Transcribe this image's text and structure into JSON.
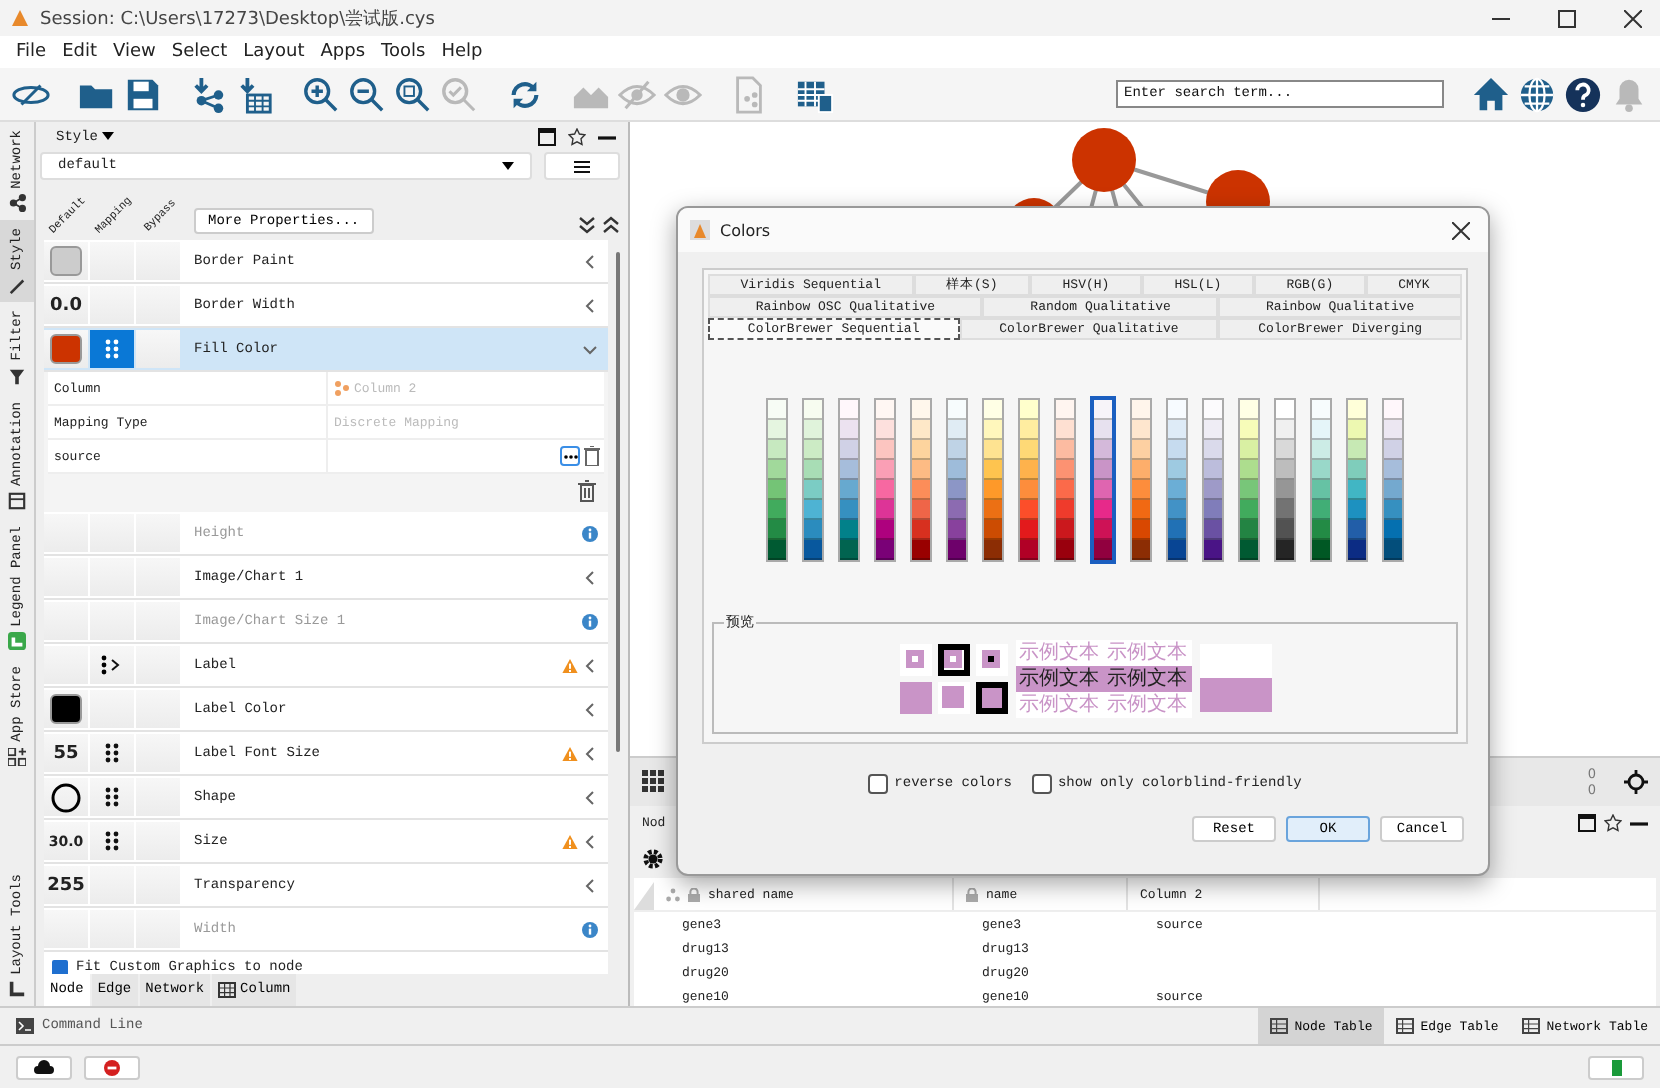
{
  "window": {
    "title": "Session: C:\\Users\\17273\\Desktop\\尝试版.cys"
  },
  "menu": [
    "File",
    "Edit",
    "View",
    "Select",
    "Layout",
    "Apps",
    "Tools",
    "Help"
  ],
  "toolbar": [
    [
      {
        "kind": "logo",
        "disabled": false
      }
    ],
    [
      {
        "kind": "open",
        "disabled": false
      },
      {
        "kind": "save",
        "disabled": false
      }
    ],
    [
      {
        "kind": "import-network",
        "disabled": false
      },
      {
        "kind": "import-table",
        "disabled": false
      }
    ],
    [
      {
        "kind": "zoom-in",
        "disabled": false
      },
      {
        "kind": "zoom-out",
        "disabled": false
      },
      {
        "kind": "zoom-fit",
        "disabled": false
      },
      {
        "kind": "zoom-selected",
        "disabled": true
      }
    ],
    [
      {
        "kind": "refresh",
        "disabled": false
      }
    ],
    [
      {
        "kind": "houses",
        "disabled": true
      },
      {
        "kind": "eye-slash",
        "disabled": true
      },
      {
        "kind": "eye",
        "disabled": true
      }
    ],
    [
      {
        "kind": "export",
        "disabled": true
      }
    ],
    [
      {
        "kind": "table",
        "disabled": false
      }
    ]
  ],
  "search": {
    "placeholder": "Enter search term..."
  },
  "toolbar_right": [
    {
      "kind": "home",
      "disabled": false
    },
    {
      "kind": "globe",
      "disabled": false
    },
    {
      "kind": "help",
      "disabled": false
    },
    {
      "kind": "bell",
      "disabled": true
    }
  ],
  "side_tabs": [
    {
      "label": "Network",
      "kind": "network",
      "selected": false
    },
    {
      "label": "Style",
      "kind": "style",
      "selected": true
    },
    {
      "label": "Filter",
      "kind": "filter",
      "selected": false
    },
    {
      "label": "Annotation",
      "kind": "annotation",
      "selected": false
    },
    {
      "label": "Legend Panel",
      "kind": "legend",
      "selected": false
    },
    {
      "label": "App Store",
      "kind": "apps",
      "selected": false
    },
    {
      "label": "Layout Tools",
      "kind": "layout",
      "selected": false
    }
  ],
  "style_panel": {
    "title": "Style",
    "style_name": "default",
    "column_headers": [
      "Default",
      "Mapping",
      "Bypass"
    ],
    "more_button": "More Properties...",
    "properties": [
      {
        "label": "Border Paint",
        "default": {
          "kind": "swatch",
          "color": "#cccccc"
        },
        "mapping": {
          "kind": "none"
        },
        "selected": false,
        "disabled": false,
        "warning": false,
        "info": false,
        "expanded": false
      },
      {
        "label": "Border Width",
        "default": {
          "kind": "number",
          "text": "0.0"
        },
        "mapping": {
          "kind": "none"
        },
        "selected": false,
        "disabled": false,
        "warning": false,
        "info": false,
        "expanded": false
      },
      {
        "label": "Fill Color",
        "default": {
          "kind": "swatch",
          "color": "#cc3300"
        },
        "mapping": {
          "kind": "discrete"
        },
        "selected": true,
        "disabled": false,
        "warning": false,
        "info": false,
        "expanded": true,
        "detail": [
          {
            "kind": "column",
            "key": "Column",
            "value": "Column 2"
          },
          {
            "kind": "type",
            "key": "Mapping Type",
            "value": "Discrete Mapping"
          },
          {
            "kind": "entry",
            "key": "source"
          }
        ]
      },
      {
        "label": "Height",
        "default": {
          "kind": "none"
        },
        "mapping": {
          "kind": "none"
        },
        "selected": false,
        "disabled": true,
        "warning": false,
        "info": true,
        "expanded": false
      },
      {
        "label": "Image/Chart 1",
        "default": {
          "kind": "none"
        },
        "mapping": {
          "kind": "none"
        },
        "selected": false,
        "disabled": false,
        "warning": false,
        "info": false,
        "expanded": false
      },
      {
        "label": "Image/Chart Size 1",
        "default": {
          "kind": "none"
        },
        "mapping": {
          "kind": "none"
        },
        "selected": false,
        "disabled": true,
        "warning": false,
        "info": true,
        "expanded": false
      },
      {
        "label": "Label",
        "default": {
          "kind": "none"
        },
        "mapping": {
          "kind": "passthrough"
        },
        "selected": false,
        "disabled": false,
        "warning": true,
        "info": false,
        "expanded": false
      },
      {
        "label": "Label Color",
        "default": {
          "kind": "swatch",
          "color": "#000000"
        },
        "mapping": {
          "kind": "none"
        },
        "selected": false,
        "disabled": false,
        "warning": false,
        "info": false,
        "expanded": false
      },
      {
        "label": "Label Font Size",
        "default": {
          "kind": "number",
          "text": "55"
        },
        "mapping": {
          "kind": "discrete"
        },
        "selected": false,
        "disabled": false,
        "warning": true,
        "info": false,
        "expanded": false
      },
      {
        "label": "Shape",
        "default": {
          "kind": "ellipse"
        },
        "mapping": {
          "kind": "discrete"
        },
        "selected": false,
        "disabled": false,
        "warning": false,
        "info": false,
        "expanded": false
      },
      {
        "label": "Size",
        "default": {
          "kind": "number",
          "text": "30.0"
        },
        "mapping": {
          "kind": "discrete"
        },
        "selected": false,
        "disabled": false,
        "warning": true,
        "info": false,
        "expanded": false
      },
      {
        "label": "Transparency",
        "default": {
          "kind": "number",
          "text": "255"
        },
        "mapping": {
          "kind": "none"
        },
        "selected": false,
        "disabled": false,
        "warning": false,
        "info": false,
        "expanded": false
      },
      {
        "label": "Width",
        "default": {
          "kind": "none"
        },
        "mapping": {
          "kind": "none"
        },
        "selected": false,
        "disabled": true,
        "warning": false,
        "info": true,
        "expanded": false
      }
    ],
    "fit_option": {
      "label": "Fit Custom Graphics to node",
      "checked": true
    },
    "bottom_tabs": [
      {
        "label": "Node",
        "kind": "plain",
        "selected": true
      },
      {
        "label": "Edge",
        "kind": "plain",
        "selected": false
      },
      {
        "label": "Network",
        "kind": "plain",
        "selected": false
      },
      {
        "label": "Column",
        "kind": "table",
        "selected": false
      }
    ]
  },
  "view_counts": [
    "0",
    "0"
  ],
  "table_panel": {
    "title": "Nod",
    "columns": [
      {
        "label": "shared name",
        "kind": "shared"
      },
      {
        "label": "name",
        "kind": "locked"
      },
      {
        "label": "Column 2",
        "kind": "plain"
      }
    ],
    "rows": [
      [
        "gene3",
        "gene3",
        "source"
      ],
      [
        "drug13",
        "drug13",
        null
      ],
      [
        "drug20",
        "drug20",
        null
      ],
      [
        "gene10",
        "gene10",
        "source"
      ]
    ],
    "tabs": [
      {
        "label": "Node Table",
        "selected": true
      },
      {
        "label": "Edge Table",
        "selected": false
      },
      {
        "label": "Network Table",
        "selected": false
      }
    ]
  },
  "command_line": "Command Line",
  "dialog": {
    "title": "Colors",
    "tab_rows": [
      [
        {
          "label": "Viridis Sequential",
          "selected": false
        },
        {
          "label": "样本(S)",
          "selected": false
        },
        {
          "label": "HSV(H)",
          "selected": false
        },
        {
          "label": "HSL(L)",
          "selected": false
        },
        {
          "label": "RGB(G)",
          "selected": false
        },
        {
          "label": "CMYK",
          "selected": false
        }
      ],
      [
        {
          "label": "Rainbow OSC Qualitative",
          "selected": false
        },
        {
          "label": "Random Qualitative",
          "selected": false
        },
        {
          "label": "Rainbow Qualitative",
          "selected": false
        }
      ],
      [
        {
          "label": "ColorBrewer Sequential",
          "selected": true
        },
        {
          "label": "ColorBrewer Qualitative",
          "selected": false
        },
        {
          "label": "ColorBrewer Diverging",
          "selected": false
        }
      ]
    ],
    "palettes": [
      {
        "selected": false,
        "cells": [
          {
            "color": "#f7fcf5"
          },
          {
            "color": "#e5f5e0"
          },
          {
            "color": "#c7e9c0"
          },
          {
            "color": "#a1d99b"
          },
          {
            "color": "#74c476"
          },
          {
            "color": "#41ab5d"
          },
          {
            "color": "#238b45"
          },
          {
            "color": "#005a32"
          }
        ]
      },
      {
        "selected": false,
        "cells": [
          {
            "color": "#f7fcf0"
          },
          {
            "color": "#e0f3db"
          },
          {
            "color": "#ccebc5"
          },
          {
            "color": "#a8ddb5"
          },
          {
            "color": "#7bccc4"
          },
          {
            "color": "#4eb3d3"
          },
          {
            "color": "#2b8cbe"
          },
          {
            "color": "#08589e"
          }
        ]
      },
      {
        "selected": false,
        "cells": [
          {
            "color": "#fff7fb"
          },
          {
            "color": "#ece2f0"
          },
          {
            "color": "#d0d1e6"
          },
          {
            "color": "#a6bddb"
          },
          {
            "color": "#67a9cf"
          },
          {
            "color": "#3690c0"
          },
          {
            "color": "#02818a"
          },
          {
            "color": "#016450"
          }
        ]
      },
      {
        "selected": false,
        "cells": [
          {
            "color": "#fff7f3"
          },
          {
            "color": "#fde0dd"
          },
          {
            "color": "#fcc5c0"
          },
          {
            "color": "#fa9fb5"
          },
          {
            "color": "#f768a1"
          },
          {
            "color": "#dd3497"
          },
          {
            "color": "#ae017e"
          },
          {
            "color": "#7a0177"
          }
        ]
      },
      {
        "selected": false,
        "cells": [
          {
            "color": "#fff7ec"
          },
          {
            "color": "#fee8c8"
          },
          {
            "color": "#fdd49e"
          },
          {
            "color": "#fdbb84"
          },
          {
            "color": "#fc8d59"
          },
          {
            "color": "#ef6548"
          },
          {
            "color": "#d7301f"
          },
          {
            "color": "#990000"
          }
        ]
      },
      {
        "selected": false,
        "cells": [
          {
            "color": "#f7fcfd"
          },
          {
            "color": "#e0ecf4"
          },
          {
            "color": "#bfd3e6"
          },
          {
            "color": "#9ebcda"
          },
          {
            "color": "#8c96c6"
          },
          {
            "color": "#8c6bb1"
          },
          {
            "color": "#88419d"
          },
          {
            "color": "#6e016b"
          }
        ]
      },
      {
        "selected": false,
        "cells": [
          {
            "color": "#ffffe5"
          },
          {
            "color": "#fff7bc"
          },
          {
            "color": "#fee391"
          },
          {
            "color": "#fec44f"
          },
          {
            "color": "#fe9929"
          },
          {
            "color": "#ec7014"
          },
          {
            "color": "#cc4c02"
          },
          {
            "color": "#8c2d04"
          }
        ]
      },
      {
        "selected": false,
        "cells": [
          {
            "color": "#ffffcc"
          },
          {
            "color": "#ffeda0"
          },
          {
            "color": "#fed976"
          },
          {
            "color": "#feb24c"
          },
          {
            "color": "#fd8d3c"
          },
          {
            "color": "#fc4e2a"
          },
          {
            "color": "#e31a1c"
          },
          {
            "color": "#b10026"
          }
        ]
      },
      {
        "selected": false,
        "cells": [
          {
            "color": "#fff5f0"
          },
          {
            "color": "#fee0d2"
          },
          {
            "color": "#fcbba1"
          },
          {
            "color": "#fc9272"
          },
          {
            "color": "#fb6a4a"
          },
          {
            "color": "#ef3b2c"
          },
          {
            "color": "#cb181d"
          },
          {
            "color": "#99000d"
          }
        ]
      },
      {
        "selected": true,
        "cells": [
          {
            "color": "#f7f4f9"
          },
          {
            "color": "#e7e1ef"
          },
          {
            "color": "#d4b9da"
          },
          {
            "color": "#c994c7"
          },
          {
            "color": "#df65b0"
          },
          {
            "color": "#e7298a"
          },
          {
            "color": "#ce1256"
          },
          {
            "color": "#91003f"
          }
        ]
      },
      {
        "selected": false,
        "cells": [
          {
            "color": "#fff5eb"
          },
          {
            "color": "#fee6ce"
          },
          {
            "color": "#fdd0a2"
          },
          {
            "color": "#fdae6b"
          },
          {
            "color": "#fd8d3c"
          },
          {
            "color": "#f16913"
          },
          {
            "color": "#d94801"
          },
          {
            "color": "#8c2d04"
          }
        ]
      },
      {
        "selected": false,
        "cells": [
          {
            "color": "#f7fbff"
          },
          {
            "color": "#deebf7"
          },
          {
            "color": "#c6dbef"
          },
          {
            "color": "#9ecae1"
          },
          {
            "color": "#6baed6"
          },
          {
            "color": "#4292c6"
          },
          {
            "color": "#2171b5"
          },
          {
            "color": "#084594"
          }
        ]
      },
      {
        "selected": false,
        "cells": [
          {
            "color": "#fcfbfd"
          },
          {
            "color": "#efedf5"
          },
          {
            "color": "#dadaeb"
          },
          {
            "color": "#bcbddc"
          },
          {
            "color": "#9e9ac8"
          },
          {
            "color": "#807dba"
          },
          {
            "color": "#6a51a3"
          },
          {
            "color": "#4a1486"
          }
        ]
      },
      {
        "selected": false,
        "cells": [
          {
            "color": "#ffffe5"
          },
          {
            "color": "#f7fcb9"
          },
          {
            "color": "#d9f0a3"
          },
          {
            "color": "#addd8e"
          },
          {
            "color": "#78c679"
          },
          {
            "color": "#41ab5d"
          },
          {
            "color": "#238443"
          },
          {
            "color": "#005a32"
          }
        ]
      },
      {
        "selected": false,
        "cells": [
          {
            "color": "#ffffff"
          },
          {
            "color": "#f0f0f0"
          },
          {
            "color": "#d9d9d9"
          },
          {
            "color": "#bdbdbd"
          },
          {
            "color": "#969696"
          },
          {
            "color": "#737373"
          },
          {
            "color": "#525252"
          },
          {
            "color": "#252525"
          }
        ]
      },
      {
        "selected": false,
        "cells": [
          {
            "color": "#f7fcfd"
          },
          {
            "color": "#e5f5f9"
          },
          {
            "color": "#ccece6"
          },
          {
            "color": "#99d8c9"
          },
          {
            "color": "#66c2a4"
          },
          {
            "color": "#41ae76"
          },
          {
            "color": "#238b45"
          },
          {
            "color": "#005824"
          }
        ]
      },
      {
        "selected": false,
        "cells": [
          {
            "color": "#ffffd9"
          },
          {
            "color": "#edf8b1"
          },
          {
            "color": "#c7e9b4"
          },
          {
            "color": "#7fcdbb"
          },
          {
            "color": "#41b6c4"
          },
          {
            "color": "#1d91c0"
          },
          {
            "color": "#225ea8"
          },
          {
            "color": "#0c2c84"
          }
        ]
      },
      {
        "selected": false,
        "cells": [
          {
            "color": "#fff7fb"
          },
          {
            "color": "#ece7f2"
          },
          {
            "color": "#d0d1e6"
          },
          {
            "color": "#a6bddb"
          },
          {
            "color": "#74a9cf"
          },
          {
            "color": "#3690c0"
          },
          {
            "color": "#0570b0"
          },
          {
            "color": "#034e7b"
          }
        ]
      }
    ],
    "preview": {
      "title": "预览",
      "color": "#c994c7",
      "samples": [
        "示例文本",
        "示例文本",
        "示例文本",
        "示例文本",
        "示例文本",
        "示例文本"
      ]
    },
    "options": [
      {
        "label": "reverse colors",
        "checked": false
      },
      {
        "label": "show only colorblind-friendly",
        "checked": false
      }
    ],
    "buttons": [
      {
        "label": "Reset",
        "default": false
      },
      {
        "label": "OK",
        "default": true
      },
      {
        "label": "Cancel",
        "default": false
      }
    ]
  }
}
